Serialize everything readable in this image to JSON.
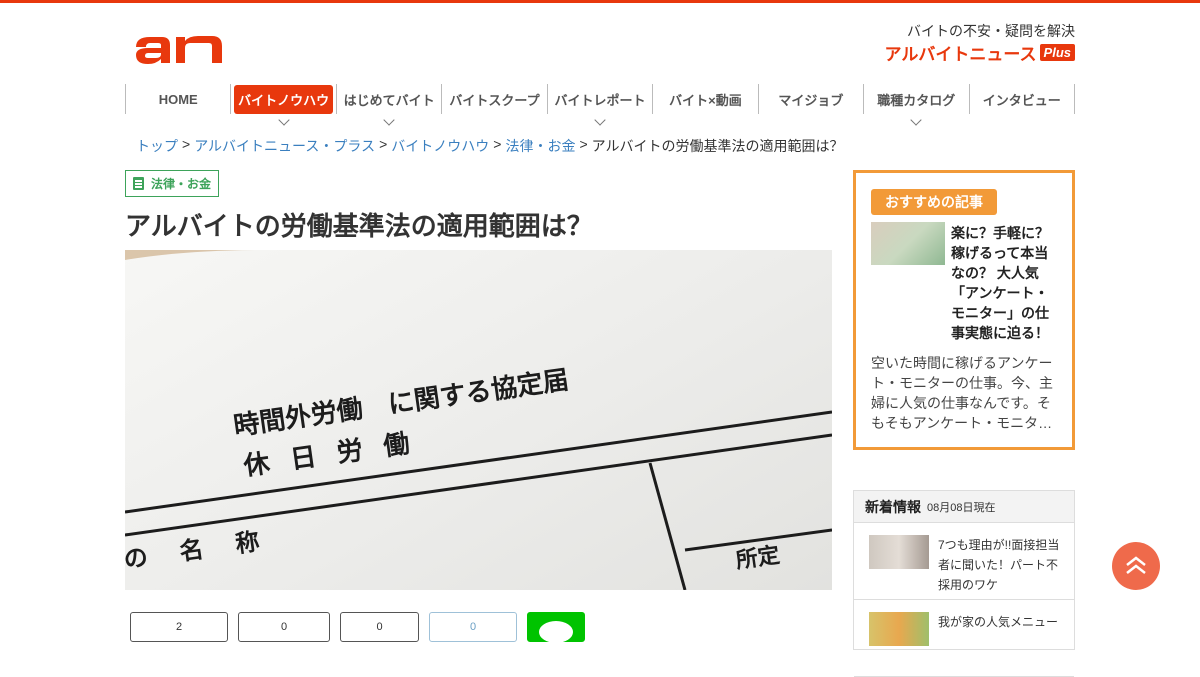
{
  "header": {
    "logo_text": "an",
    "tagline": "バイトの不安・疑問を解決",
    "brand": "アルバイトニュース",
    "brand_plus": "Plus"
  },
  "nav": {
    "items": [
      {
        "label": "HOME",
        "dropdown": false
      },
      {
        "label": "バイトノウハウ",
        "dropdown": true,
        "active": true
      },
      {
        "label": "はじめてバイト",
        "dropdown": true
      },
      {
        "label": "バイトスクープ",
        "dropdown": false
      },
      {
        "label": "バイトレポート",
        "dropdown": true
      },
      {
        "label": "バイト×動画",
        "dropdown": false
      },
      {
        "label": "マイジョブ",
        "dropdown": false
      },
      {
        "label": "職種カタログ",
        "dropdown": true
      },
      {
        "label": "インタビュー",
        "dropdown": false
      }
    ]
  },
  "breadcrumb": {
    "items": [
      "トップ",
      "アルバイトニュース・プラス",
      "バイトノウハウ",
      "法律・お金"
    ],
    "separator": ">",
    "current": "アルバイトの労働基準法の適用範囲は？"
  },
  "article": {
    "category": "法律・お金",
    "title": "アルバイトの労働基準法の適用範囲は？",
    "hero": {
      "line1": "時間外労働　に関する協定届",
      "line2": "休 日 労 働",
      "line3": "の 名 称",
      "line4": "所定"
    },
    "share_counts": [
      "2",
      "0",
      "0",
      "0"
    ]
  },
  "recommend": {
    "tag": "おすすめの記事",
    "title": "楽に？手軽に？稼げるって本当なの？ 大人気「アンケート・モニター」の仕事実態に迫る！",
    "desc": "空いた時間に稼げるアンケート・モニターの仕事。今、主婦に人気の仕事なんです。そもそもアンケート・モニタ…"
  },
  "news": {
    "title": "新着情報",
    "date": "08月08日現在",
    "items": [
      {
        "text": "7つも理由が!!面接担当者に聞いた！パート不採用のワケ"
      },
      {
        "text": "我が家の人気メニュー"
      }
    ]
  },
  "colors": {
    "brand": "#e8380d",
    "accent_orange": "#f29a38",
    "category_green": "#3da35a",
    "link": "#3a7fbf"
  }
}
